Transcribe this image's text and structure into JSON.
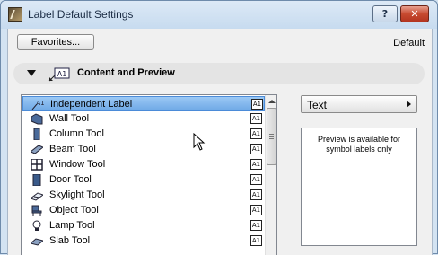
{
  "window": {
    "title": "Label Default Settings",
    "help_label": "?",
    "close_label": "✕"
  },
  "toolbar": {
    "favorites_label": "Favorites...",
    "default_label": "Default"
  },
  "section": {
    "title": "Content and Preview",
    "badge": "A1"
  },
  "list": {
    "items": [
      {
        "label": "Independent Label",
        "icon": "independent-label-icon",
        "badge": "A1",
        "selected": true
      },
      {
        "label": "Wall Tool",
        "icon": "wall-tool-icon",
        "badge": "A1"
      },
      {
        "label": "Column Tool",
        "icon": "column-tool-icon",
        "badge": "A1"
      },
      {
        "label": "Beam Tool",
        "icon": "beam-tool-icon",
        "badge": "A1"
      },
      {
        "label": "Window Tool",
        "icon": "window-tool-icon",
        "badge": "A1"
      },
      {
        "label": "Door Tool",
        "icon": "door-tool-icon",
        "badge": "A1"
      },
      {
        "label": "Skylight Tool",
        "icon": "skylight-tool-icon",
        "badge": "A1"
      },
      {
        "label": "Object Tool",
        "icon": "object-tool-icon",
        "badge": "A1"
      },
      {
        "label": "Lamp Tool",
        "icon": "lamp-tool-icon",
        "badge": "A1"
      },
      {
        "label": "Slab Tool",
        "icon": "slab-tool-icon",
        "badge": "A1"
      }
    ]
  },
  "type_select": {
    "value": "Text"
  },
  "preview": {
    "message": "Preview is available for symbol labels only"
  },
  "colors": {
    "selection": "#6ea9e6",
    "titlebar": "#c7dbef",
    "close": "#c74a30"
  }
}
